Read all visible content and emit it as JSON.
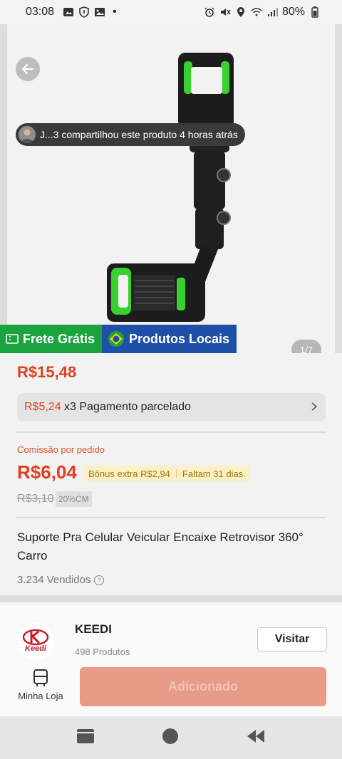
{
  "status_bar": {
    "time": "03:08",
    "dot": "•",
    "battery": "80%",
    "left_icons": [
      "gallery-icon",
      "shield-icon",
      "image-icon"
    ],
    "right_icons": [
      "alarm-icon",
      "mute-icon",
      "location-icon",
      "wifi-icon",
      "signal-icon",
      "battery-icon"
    ]
  },
  "product_image": {
    "share_toast": "J...3 compartilhou este produto 4 horas atrás",
    "counter": "1/7"
  },
  "badges": {
    "frete": "Frete Grátis",
    "locais": "Produtos Locais"
  },
  "price": {
    "current": "R$15,48",
    "installment_amount": "R$5,24",
    "installment_text": " x3 Pagamento parcelado"
  },
  "commission": {
    "label": "Comissão por pedido",
    "value": "R$6,04",
    "bonus": "Bônus extra R$2,94",
    "days_left": "Faltam 31 dias.",
    "old_value": "R$3,10",
    "percent": "20%CM"
  },
  "product": {
    "title": "Suporte Pra Celular Veicular Encaixe Retrovisor 360° Carro",
    "sold": "3.234 Vendidos"
  },
  "store": {
    "logo_text": "Keedi",
    "name": "KEEDI",
    "product_count": "498 Produtos",
    "visit_label": "Visitar"
  },
  "bottom": {
    "my_shop_label": "Minha Loja",
    "add_label": "Adicionado"
  },
  "colors": {
    "price_red": "#e0401f",
    "frete_green": "#1aa33f",
    "local_blue": "#1f4fa6",
    "add_button": "#e89b86"
  }
}
